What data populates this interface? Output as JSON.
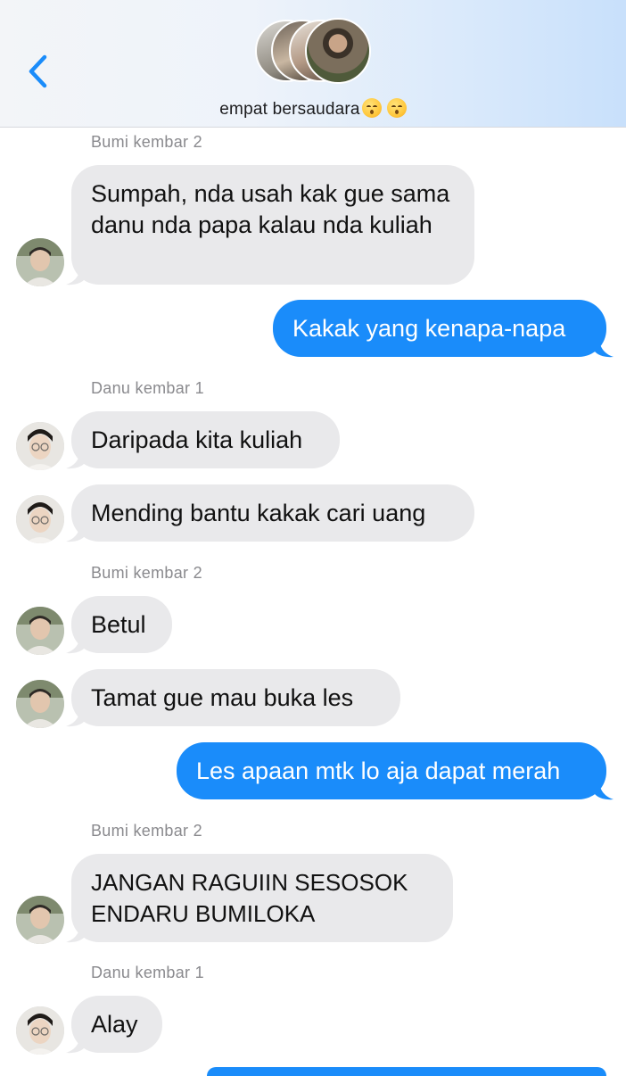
{
  "header": {
    "group_name": "empat bersaudara",
    "emojis": [
      "kissing-face-icon",
      "kissing-face-icon"
    ]
  },
  "messages": [
    {
      "sender": "Bumi kembar 2"
    },
    {
      "text": "Sumpah, nda usah kak gue sama danu nda papa kalau nda kuliah"
    },
    {
      "text": "Kakak yang kenapa-napa"
    },
    {
      "sender": "Danu kembar 1"
    },
    {
      "text": "Daripada kita kuliah"
    },
    {
      "text": "Mending bantu kakak cari uang"
    },
    {
      "sender": "Bumi kembar 2"
    },
    {
      "text": "Betul"
    },
    {
      "text": "Tamat gue mau buka les"
    },
    {
      "text": "Les apaan mtk lo aja dapat merah"
    },
    {
      "sender": "Bumi kembar 2"
    },
    {
      "text": "JANGAN RAGUIIN SESOSOK ENDARU BUMILOKA"
    },
    {
      "sender": "Danu kembar 1"
    },
    {
      "text": "Alay"
    }
  ],
  "colors": {
    "incoming_bubble": "#e9e9eb",
    "outgoing_bubble": "#1a8cfa",
    "accent": "#1a8cfa"
  }
}
